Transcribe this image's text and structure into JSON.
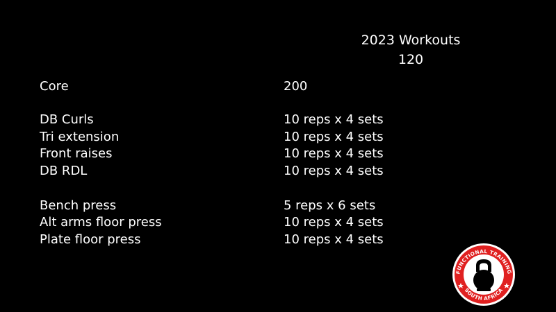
{
  "header": {
    "title": "2023 Workouts",
    "number": "120"
  },
  "rows": [
    {
      "name": "Core",
      "value": "200"
    },
    {
      "name": "DB Curls",
      "value": "10 reps x 4 sets"
    },
    {
      "name": "Tri extension",
      "value": "10 reps x 4 sets"
    },
    {
      "name": "Front raises",
      "value": "10 reps x 4 sets"
    },
    {
      "name": "DB RDL",
      "value": "10 reps x 4 sets"
    },
    {
      "name": "Bench press",
      "value": "5 reps x 6 sets"
    },
    {
      "name": "Alt arms floor press",
      "value": "10 reps x 4 sets"
    },
    {
      "name": "Plate floor press",
      "value": "10 reps x 4 sets"
    }
  ],
  "logo": {
    "text": "FUNCTIONAL TRAINING SOUTH AFRICA",
    "icon": "kettlebell-icon",
    "colors": {
      "ring": "#e02020",
      "inner": "#ffffff",
      "mark": "#000000"
    }
  }
}
